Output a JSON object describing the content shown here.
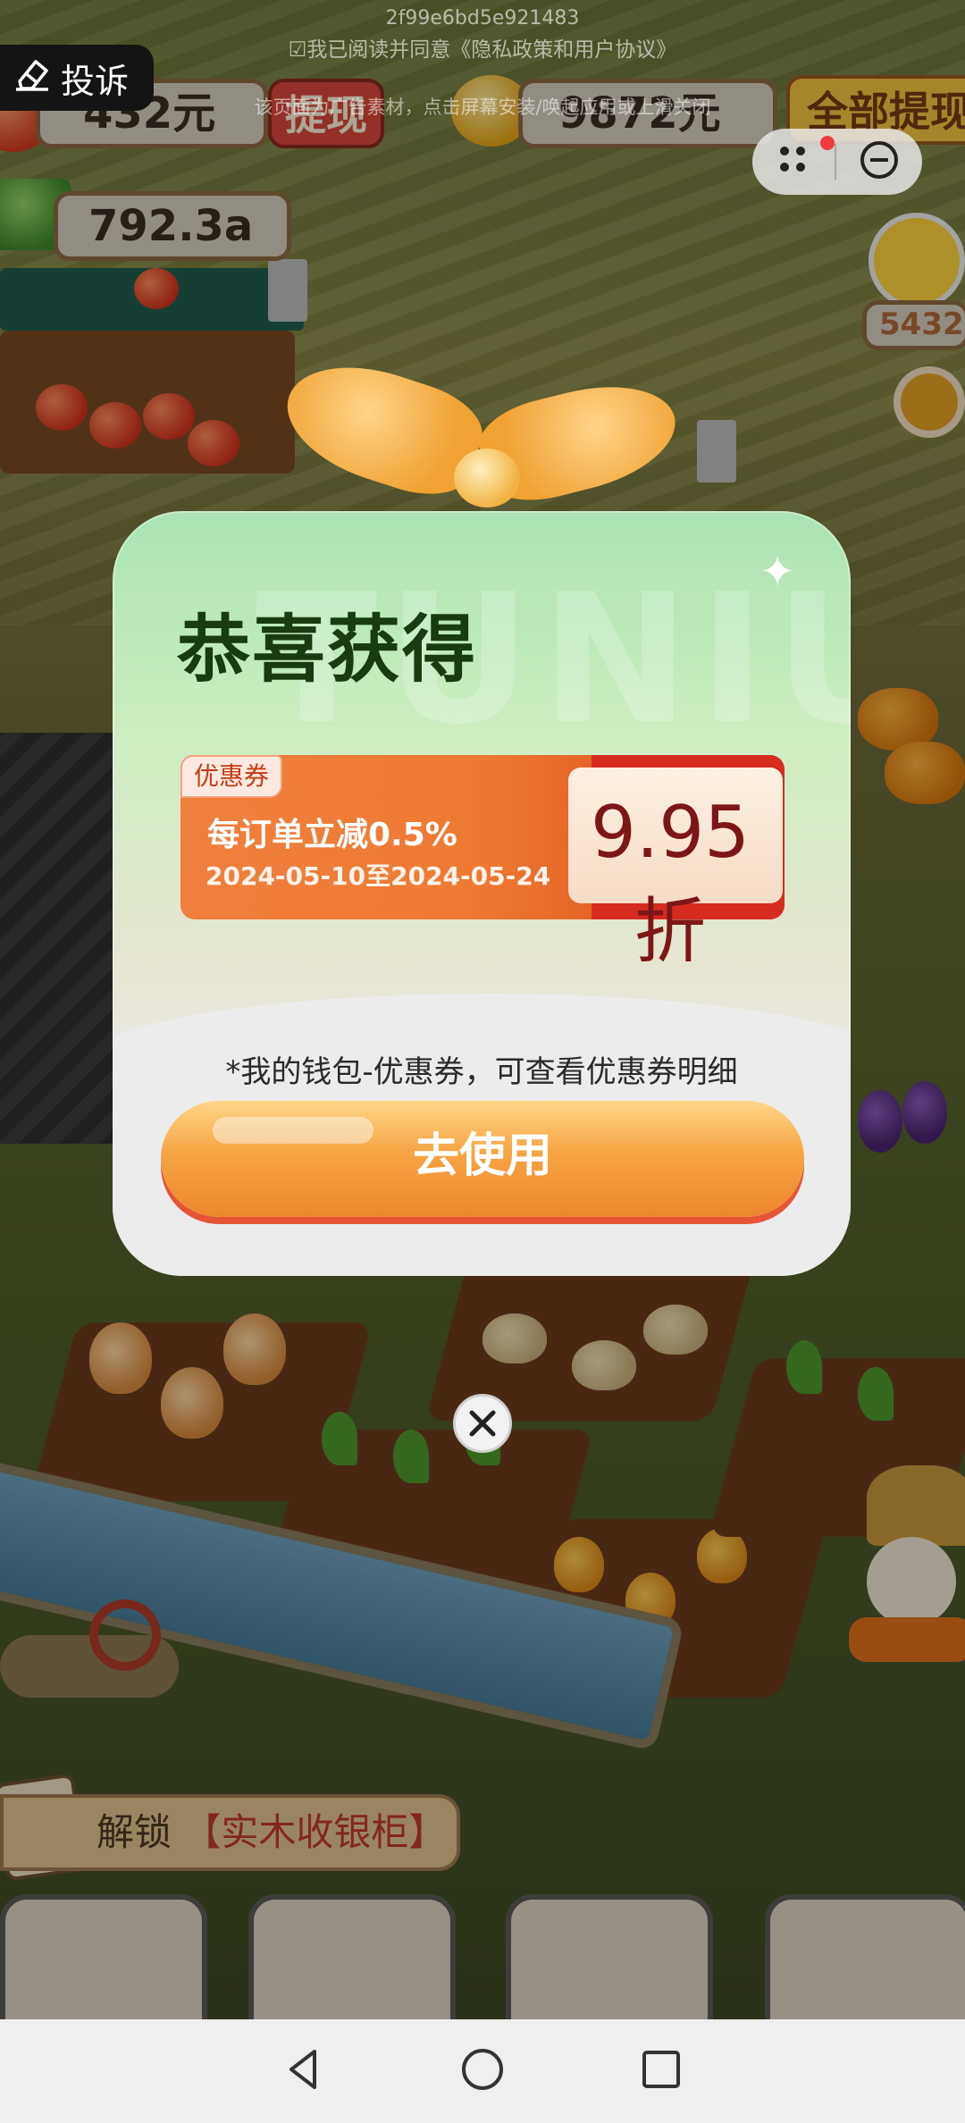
{
  "top_notice": {
    "id": "2f99e6bd5e921483",
    "agree": "☑我已阅读并同意《隐私政策和用户协议》",
    "hint": "该页面为广告素材，点击屏幕安装/唤起应用或上滑关闭"
  },
  "complain": {
    "label": "投诉",
    "icon": "pencil-eraser-icon"
  },
  "hud": {
    "balance": "432元",
    "withdraw": "提现",
    "gold": "9872元",
    "withdraw_all": "全部提现",
    "cash_counter": "792.3a",
    "score": "5432"
  },
  "modal": {
    "watermark": "TUNIU",
    "title": "恭喜获得",
    "coupon": {
      "badge": "优惠券",
      "description": "每订单立减0.5%",
      "date_range": "2024-05-10至2024-05-24",
      "value": "9.95折"
    },
    "tip": "*我的钱包-优惠券，可查看优惠券明细",
    "use_button": "去使用"
  },
  "unlock": {
    "prefix": "解锁",
    "item": "【实木收银柜】"
  },
  "colors": {
    "title_green": "#1a3a12",
    "coupon_orange": "#f07f3e",
    "coupon_value": "#7d1717",
    "button_orange": "#f6a443"
  }
}
